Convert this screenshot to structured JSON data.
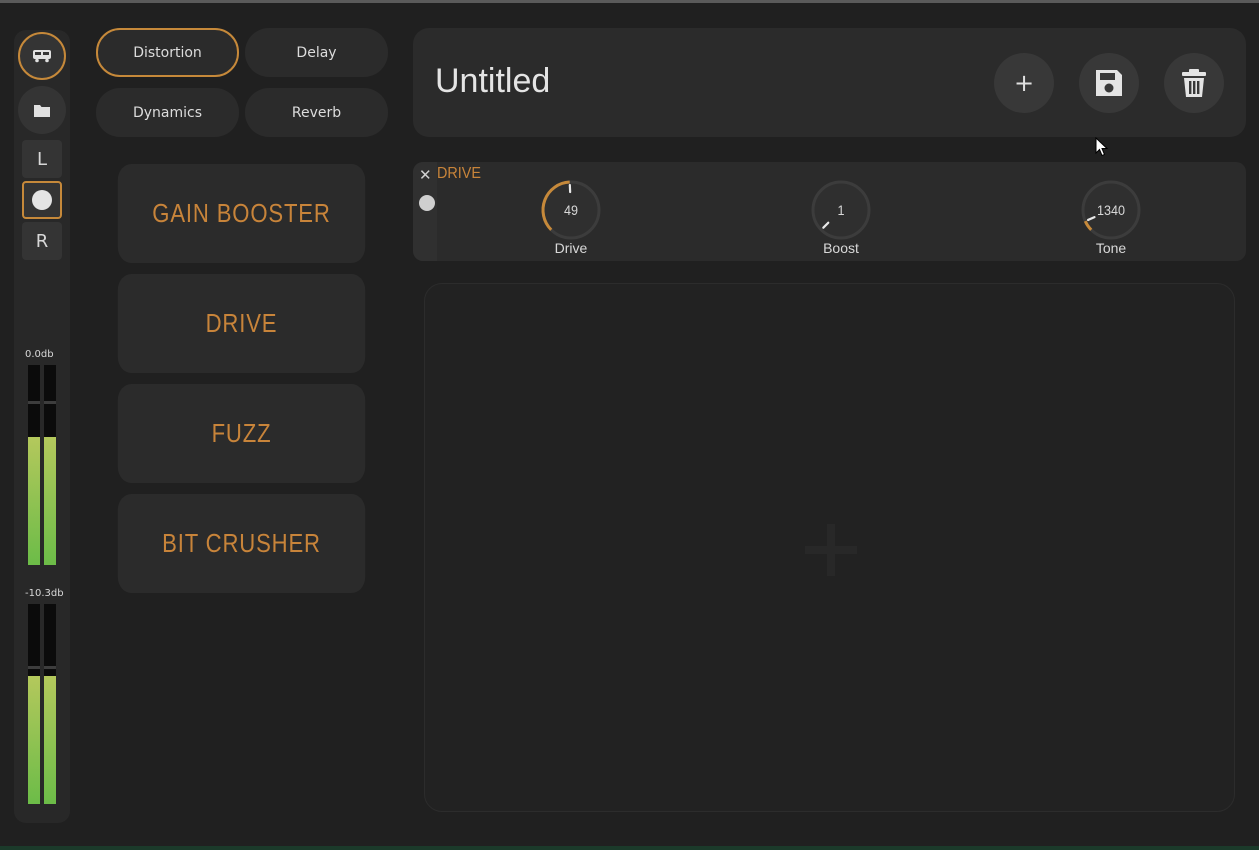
{
  "rail": {
    "icons": [
      "bus-icon",
      "folder-icon"
    ],
    "left_label": "L",
    "right_label": "R",
    "meters": [
      {
        "label": "0.0db",
        "levels": [
          0.64,
          0.64
        ],
        "peaks": [
          0.82,
          0.82
        ]
      },
      {
        "label": "-10.3db",
        "levels": [
          0.64,
          0.64
        ],
        "peaks": [
          0.69,
          0.69
        ]
      }
    ]
  },
  "categories": [
    {
      "label": "Distortion",
      "active": true
    },
    {
      "label": "Delay",
      "active": false
    },
    {
      "label": "Dynamics",
      "active": false
    },
    {
      "label": "Reverb",
      "active": false
    }
  ],
  "effects": [
    "GAIN BOOSTER",
    "DRIVE",
    "FUZZ",
    "BIT CRUSHER"
  ],
  "header": {
    "title": "Untitled",
    "buttons": {
      "add": "+",
      "save_icon": "save-icon",
      "delete_icon": "trash-icon"
    }
  },
  "module": {
    "close": "✕",
    "name": "DRIVE",
    "knobs": [
      {
        "label": "Drive",
        "value": "49",
        "fraction": 0.49
      },
      {
        "label": "Boost",
        "value": "1",
        "fraction": 0.0
      },
      {
        "label": "Tone",
        "value": "1340",
        "fraction": 0.08
      }
    ]
  },
  "colors": {
    "accent": "#c6893a",
    "background": "#202020",
    "panel": "#2b2b2b",
    "meter_green": "#6cbc48"
  }
}
